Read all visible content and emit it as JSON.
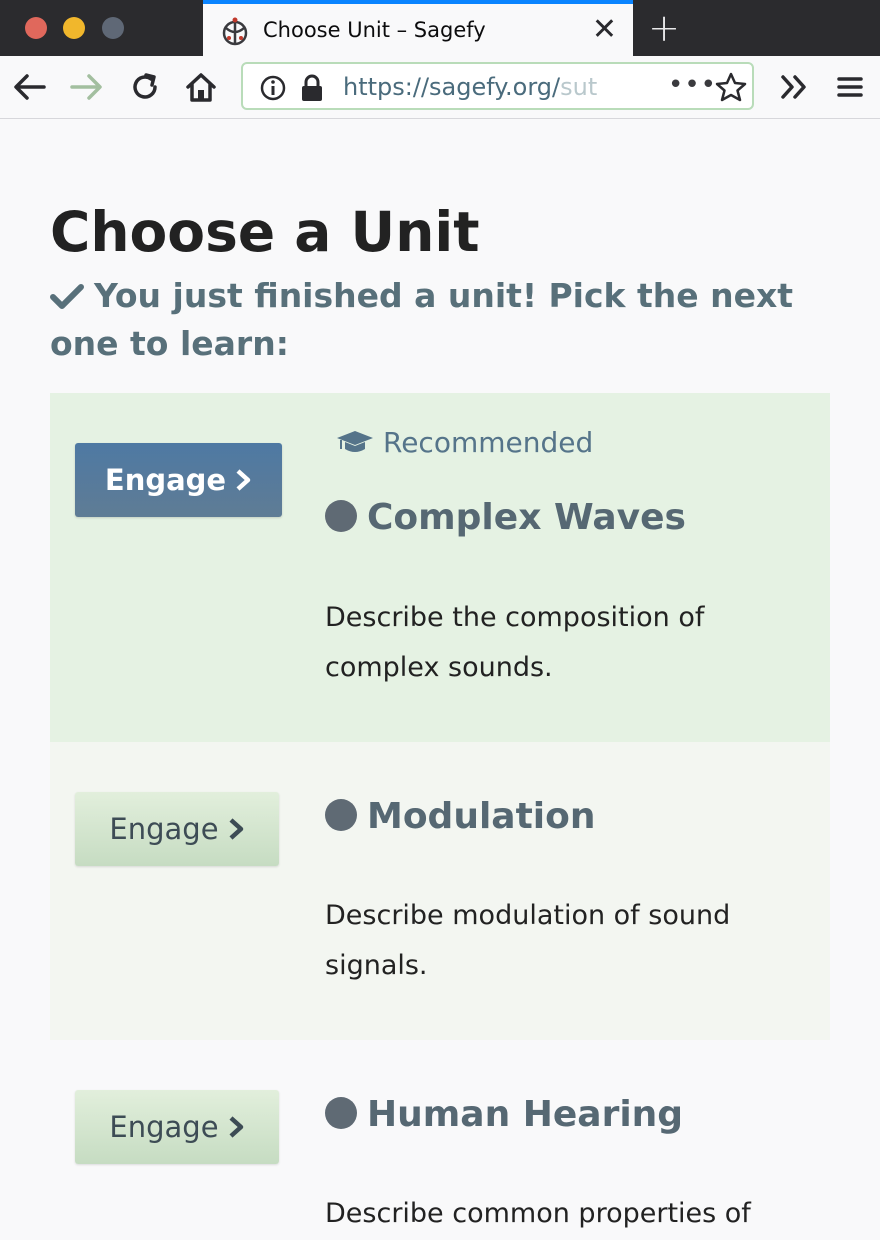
{
  "browser": {
    "tab_title": "Choose Unit – Sagefy",
    "url_main": "https://sagefy.org/",
    "url_faded": "sut",
    "url_more": "•••"
  },
  "page": {
    "title": "Choose a Unit",
    "subtitle": "You just finished a unit! Pick the next one to learn:"
  },
  "units": [
    {
      "engage_label": "Engage",
      "recommended_label": "Recommended",
      "name": "Complex Waves",
      "description": "Describe the composition of complex sounds."
    },
    {
      "engage_label": "Engage",
      "name": "Modulation",
      "description": "Describe modulation of sound signals."
    },
    {
      "engage_label": "Engage",
      "name": "Human Hearing",
      "description": "Describe common properties of"
    }
  ],
  "colors": {
    "tab_accent": "#0a84ff",
    "primary_button": "#4e79a3",
    "recommended_bg": "#e5f2e3",
    "secondary_button": "#d4e6cf"
  },
  "icons": [
    "back-icon",
    "forward-icon",
    "reload-icon",
    "home-icon",
    "info-icon",
    "lock-icon",
    "bookmark-star-icon",
    "overflow-icon",
    "menu-icon",
    "checkmark-icon",
    "graduation-cap-icon",
    "chevron-right-icon"
  ]
}
